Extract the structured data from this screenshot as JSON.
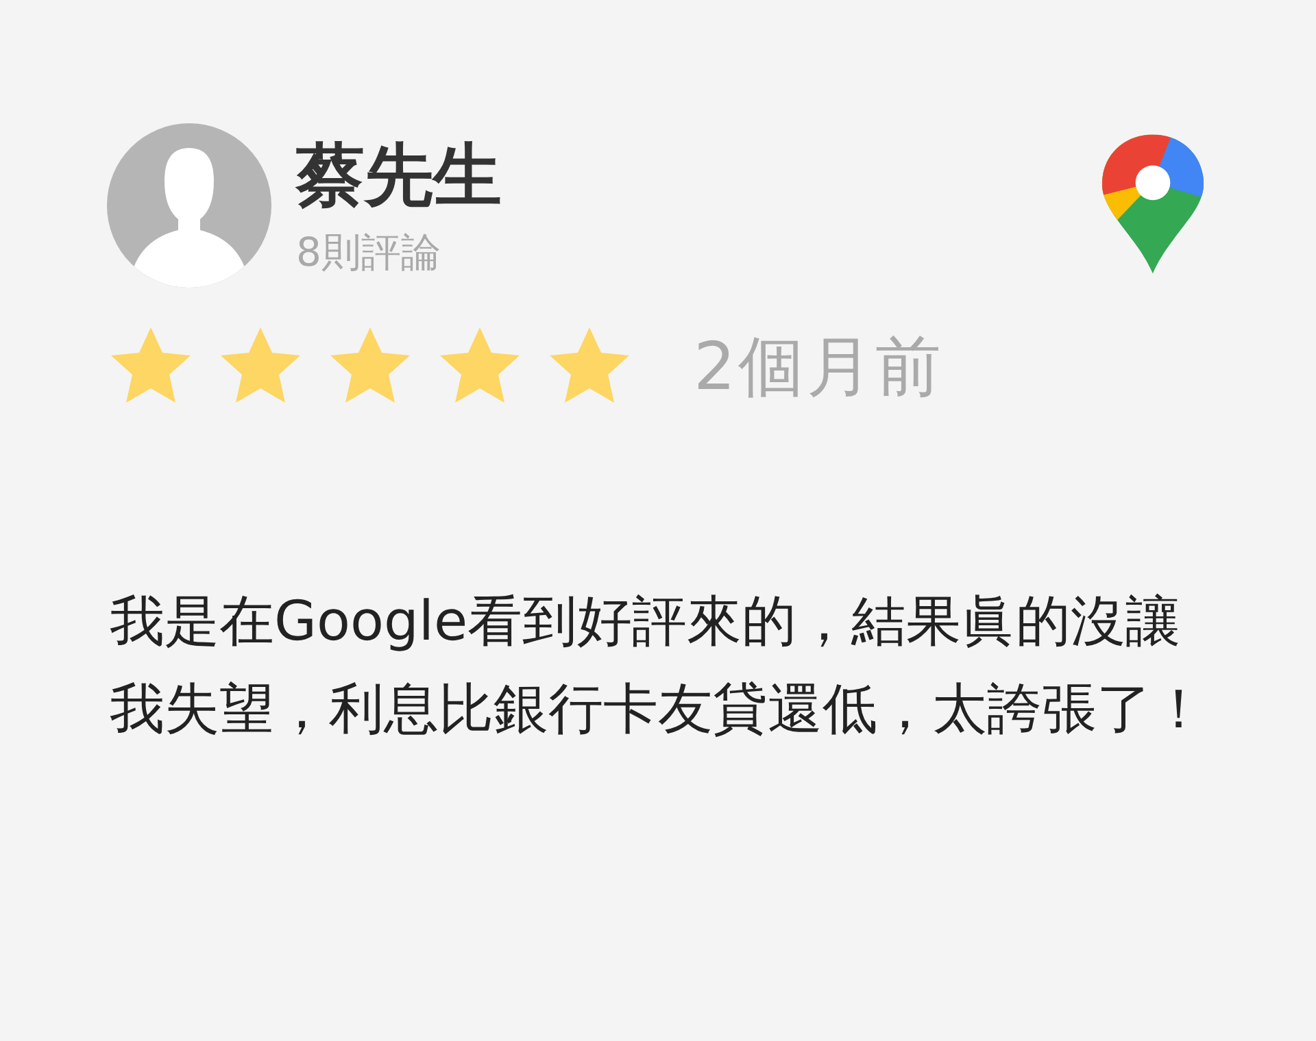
{
  "review": {
    "author": "蔡先生",
    "review_count": "8則評論",
    "stars": 5,
    "time": "2個月前",
    "text": "我是在Google看到好評來的，結果眞的沒讓我失望，利息比銀行卡友貸還低，太誇張了！"
  }
}
